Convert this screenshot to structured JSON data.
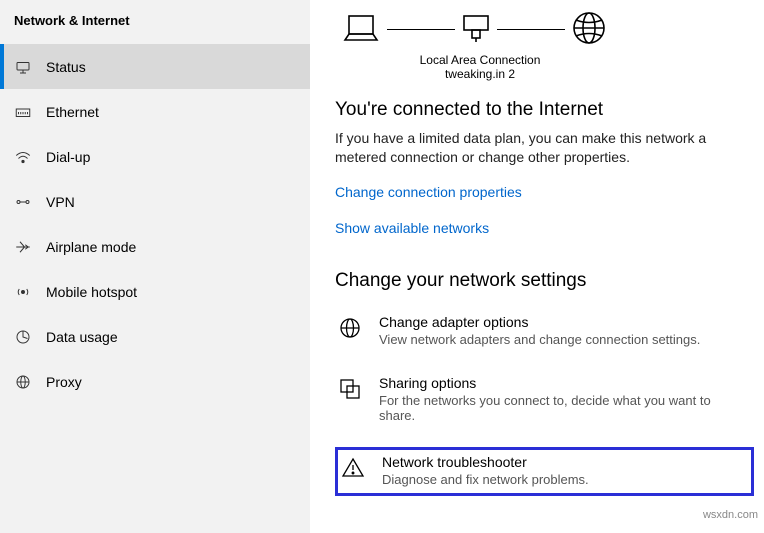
{
  "sidebar": {
    "title": "Network & Internet",
    "items": [
      {
        "label": "Status",
        "icon": "status-icon",
        "active": true
      },
      {
        "label": "Ethernet",
        "icon": "ethernet-icon",
        "active": false
      },
      {
        "label": "Dial-up",
        "icon": "dialup-icon",
        "active": false
      },
      {
        "label": "VPN",
        "icon": "vpn-icon",
        "active": false
      },
      {
        "label": "Airplane mode",
        "icon": "airplane-icon",
        "active": false
      },
      {
        "label": "Mobile hotspot",
        "icon": "hotspot-icon",
        "active": false
      },
      {
        "label": "Data usage",
        "icon": "data-icon",
        "active": false
      },
      {
        "label": "Proxy",
        "icon": "proxy-icon",
        "active": false
      }
    ]
  },
  "diagram": {
    "label": "Local Area Connection",
    "sublabel": "tweaking.in 2"
  },
  "status": {
    "heading": "You're connected to the Internet",
    "description": "If you have a limited data plan, you can make this network a metered connection or change other properties.",
    "link_properties": "Change connection properties",
    "link_networks": "Show available networks"
  },
  "settings": {
    "heading": "Change your network settings",
    "items": [
      {
        "title": "Change adapter options",
        "desc": "View network adapters and change connection settings.",
        "icon": "adapter-icon",
        "highlight": false
      },
      {
        "title": "Sharing options",
        "desc": "For the networks you connect to, decide what you want to share.",
        "icon": "sharing-icon",
        "highlight": false
      },
      {
        "title": "Network troubleshooter",
        "desc": "Diagnose and fix network problems.",
        "icon": "troubleshoot-icon",
        "highlight": true
      }
    ]
  },
  "watermark": "wsxdn.com"
}
